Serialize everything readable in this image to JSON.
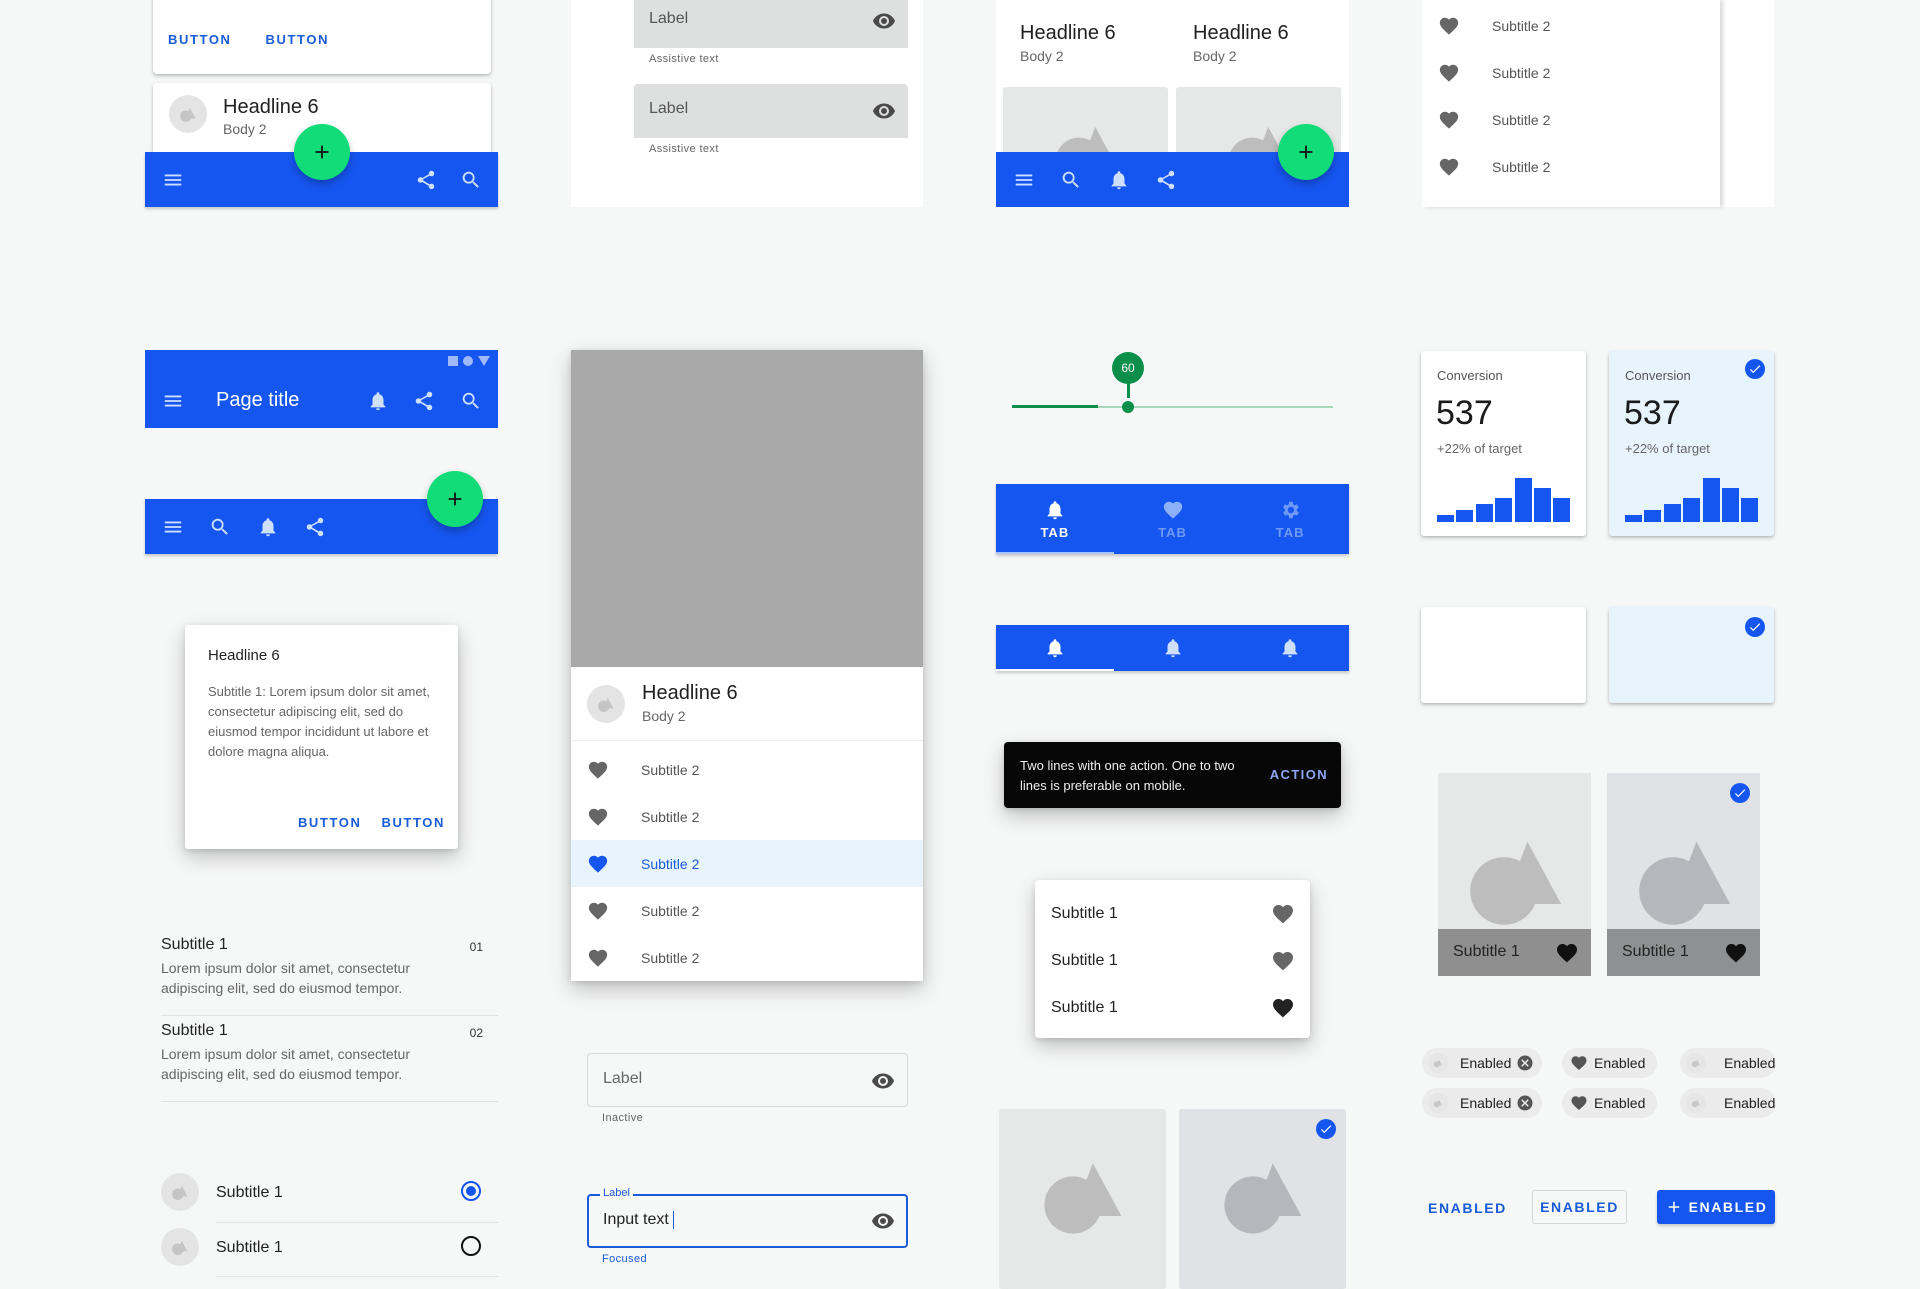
{
  "colors": {
    "primary": "#1656f0",
    "fab": "#12dc78",
    "slider": "#0b8f4b",
    "selected_bg": "#e7f4fd"
  },
  "col1": {
    "card_buttons": [
      "BUTTON",
      "BUTTON"
    ],
    "card2": {
      "title": "Headline 6",
      "subtitle": "Body 2"
    },
    "bottom_bar_icons": [
      "menu-icon",
      "share-icon",
      "search-icon"
    ],
    "top_app_bar": {
      "title": "Page title",
      "icons": [
        "bell-icon",
        "share-icon",
        "search-icon"
      ],
      "status_icons": [
        "square",
        "circle",
        "triangle"
      ]
    },
    "bottom_bar2_icons": [
      "menu-icon",
      "search-icon",
      "bell-icon",
      "share-icon"
    ],
    "dialog": {
      "title": "Headline 6",
      "body": "Subtitle 1: Lorem ipsum dolor sit amet, consectetur adipiscing elit, sed do eiusmod tempor incididunt ut labore et dolore magna aliqua.",
      "buttons": [
        "BUTTON",
        "BUTTON"
      ]
    },
    "two_line_list": [
      {
        "title": "Subtitle 1",
        "body": "Lorem ipsum dolor sit amet, consectetur adipiscing elit, sed do eiusmod tempor.",
        "meta": "01"
      },
      {
        "title": "Subtitle 1",
        "body": "Lorem ipsum dolor sit amet, consectetur adipiscing elit, sed do eiusmod tempor.",
        "meta": "02"
      }
    ],
    "radio_list": [
      {
        "label": "Subtitle 1",
        "selected": true
      },
      {
        "label": "Subtitle 1",
        "selected": false
      }
    ]
  },
  "col2": {
    "filled_fields": [
      {
        "label": "Label",
        "assistive": "Assistive text"
      },
      {
        "label": "Label",
        "assistive": "Assistive text"
      }
    ],
    "card": {
      "title": "Headline 6",
      "subtitle": "Body 2",
      "items": [
        {
          "label": "Subtitle 2",
          "selected": false
        },
        {
          "label": "Subtitle 2",
          "selected": false
        },
        {
          "label": "Subtitle 2",
          "selected": true
        },
        {
          "label": "Subtitle 2",
          "selected": false
        },
        {
          "label": "Subtitle 2",
          "selected": false
        }
      ]
    },
    "outlined_inactive": {
      "label": "Label",
      "helper": "Inactive"
    },
    "outlined_focused": {
      "label": "Label",
      "value": "Input text",
      "helper": "Focused"
    }
  },
  "col3": {
    "cards": [
      {
        "title": "Headline 6",
        "subtitle": "Body 2"
      },
      {
        "title": "Headline 6",
        "subtitle": "Body 2"
      }
    ],
    "bottom_bar_icons": [
      "menu-icon",
      "search-icon",
      "bell-icon",
      "share-icon"
    ],
    "slider": {
      "value": 60,
      "min": 0,
      "max": 100,
      "value_label": "60"
    },
    "tabs": [
      {
        "label": "TAB",
        "icon": "bell-icon",
        "active": true
      },
      {
        "label": "TAB",
        "icon": "heart-icon",
        "active": false
      },
      {
        "label": "TAB",
        "icon": "gear-icon",
        "active": false
      }
    ],
    "icon_tabs": [
      {
        "icon": "bell-icon",
        "active": true
      },
      {
        "icon": "bell-icon",
        "active": false
      },
      {
        "icon": "bell-icon",
        "active": false
      }
    ],
    "snackbar": {
      "text": "Two lines with one action. One to two lines is preferable on mobile.",
      "action": "ACTION"
    },
    "menu": [
      {
        "label": "Subtitle 1"
      },
      {
        "label": "Subtitle 1"
      },
      {
        "label": "Subtitle 1"
      }
    ],
    "image_tiles": [
      {
        "selected": false
      },
      {
        "selected": true
      }
    ]
  },
  "col4": {
    "drawer_items": [
      "Subtitle 2",
      "Subtitle 2",
      "Subtitle 2",
      "Subtitle 2"
    ],
    "stat_cards": [
      {
        "label": "Conversion",
        "value": "537",
        "delta": "+22% of target",
        "selected": false
      },
      {
        "label": "Conversion",
        "value": "537",
        "delta": "+22% of target",
        "selected": true
      }
    ],
    "stat_bars": [
      0.15,
      0.27,
      0.41,
      0.55,
      1.0,
      0.77,
      0.55
    ],
    "empty_cards": [
      {
        "selected": false
      },
      {
        "selected": true
      }
    ],
    "image_cards": [
      {
        "caption": "Subtitle 1",
        "selected": false
      },
      {
        "caption": "Subtitle 1",
        "selected": true
      }
    ],
    "chips": [
      {
        "label": "Enabled",
        "type": "input"
      },
      {
        "label": "Enabled",
        "type": "icon"
      },
      {
        "label": "Enabled",
        "type": "avatar"
      },
      {
        "label": "Enabled",
        "type": "input"
      },
      {
        "label": "Enabled",
        "type": "icon"
      },
      {
        "label": "Enabled",
        "type": "avatar"
      }
    ],
    "buttons": {
      "text": "ENABLED",
      "outlined": "ENABLED",
      "contained": "ENABLED"
    }
  }
}
